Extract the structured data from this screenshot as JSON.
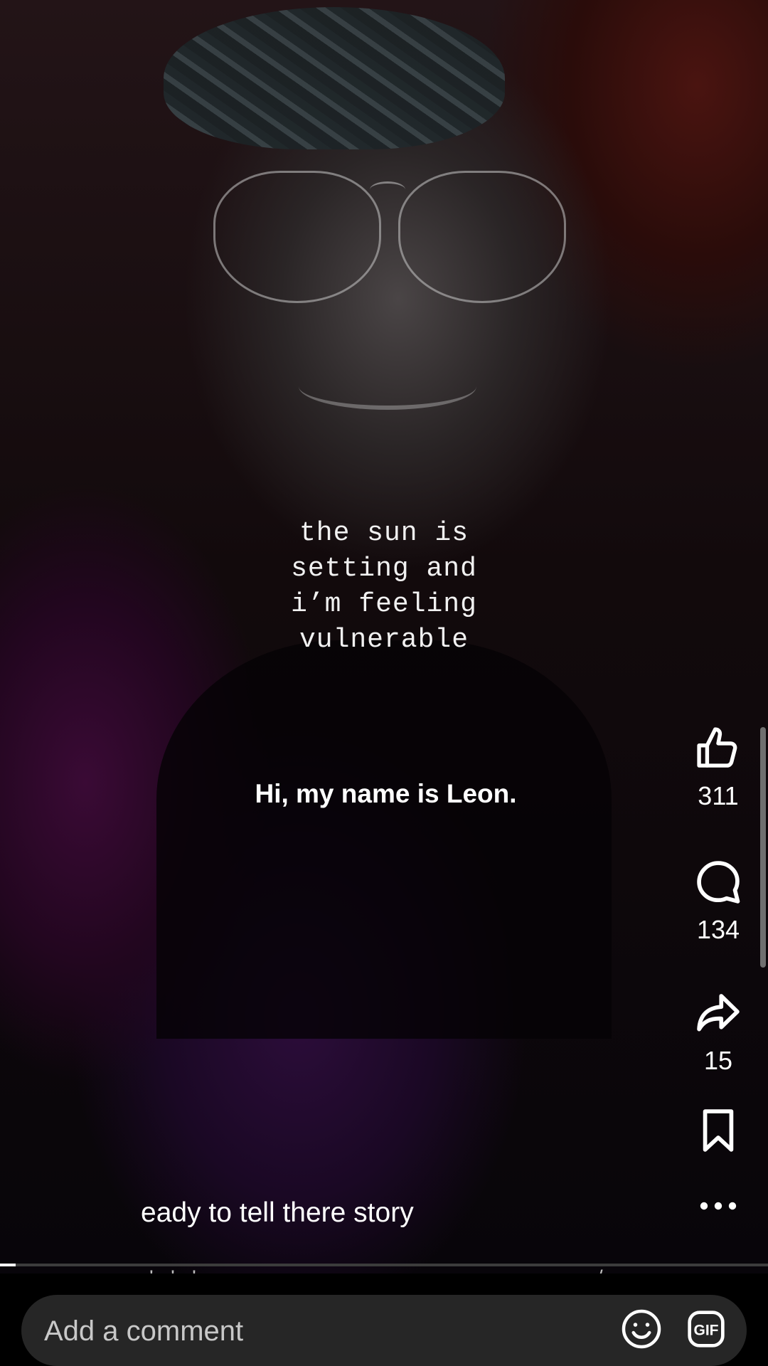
{
  "video": {
    "overlay_text": "the sun is\nsetting and\ni’m feeling\nvulnerable",
    "caption": "Hi, my name is Leon.",
    "description_line": "eady to tell there story",
    "progress": 0.02
  },
  "actions": {
    "like": {
      "icon": "thumbs-up-icon",
      "count": "311"
    },
    "comment": {
      "icon": "comment-bubble-icon",
      "count": "134"
    },
    "share": {
      "icon": "share-arrow-icon",
      "count": "15"
    },
    "save": {
      "icon": "bookmark-icon"
    },
    "more": {
      "icon": "more-dots-icon"
    }
  },
  "comment_bar": {
    "placeholder": "Add a comment",
    "emoji_icon": "smiley-icon",
    "gif_label": "GIF"
  },
  "colors": {
    "background": "#000000",
    "input_bg": "#262626",
    "text": "#ffffff",
    "placeholder": "#c8c8c8"
  }
}
